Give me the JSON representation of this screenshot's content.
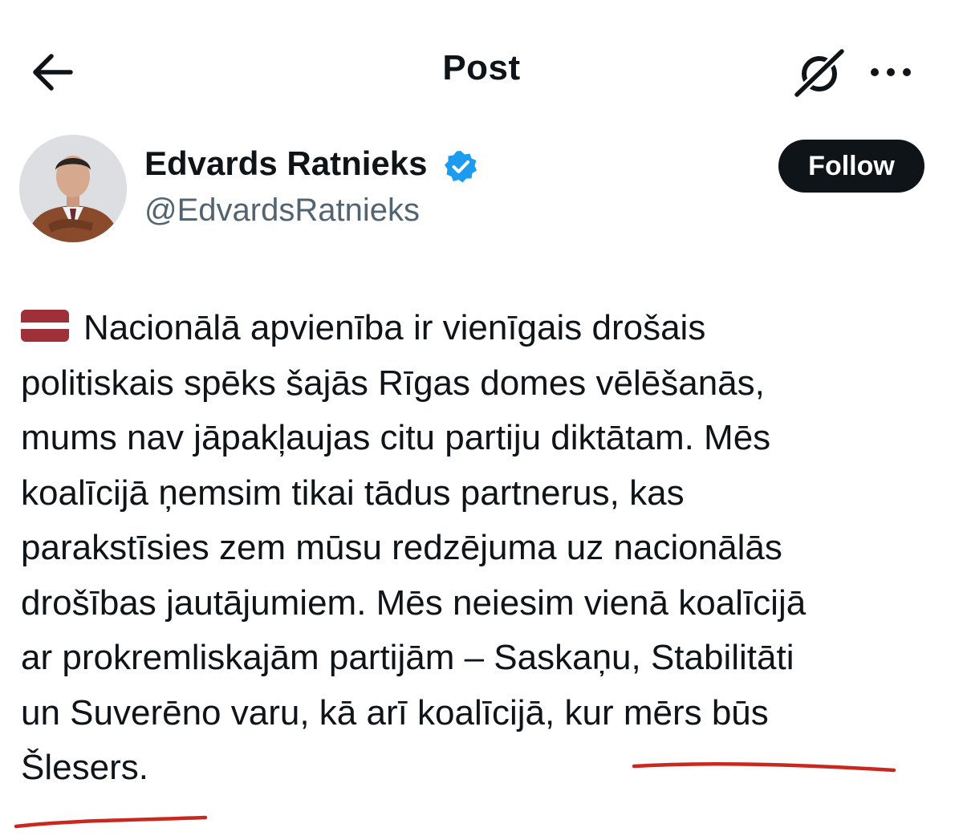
{
  "header": {
    "title": "Post",
    "back_icon": "arrow-left-icon",
    "grok_icon": "grok-icon",
    "more_icon": "more-horizontal-icon"
  },
  "author": {
    "display_name": "Edvards Ratnieks",
    "handle": "@EdvardsRatnieks",
    "verified": true,
    "verified_color": "#1d9bf0"
  },
  "follow_button": {
    "label": "Follow"
  },
  "post": {
    "flag_icon": "latvia-flag-icon",
    "lines": [
      "Nacionālā apvienība ir vienīgais drošais",
      "politiskais spēks šajās Rīgas domes vēlēšanās,",
      "mums nav jāpakļaujas citu partiju diktātam. Mēs",
      "koalīcijā ņemsim tikai tādus partnerus, kas",
      "parakstīsies zem mūsu redzējuma uz nacionālās",
      "drošības jautājumiem. Mēs neiesim vienā koalīcijā",
      "ar prokremliskajām partijām – Saskaņu, Stabilitāti",
      "un Suverēno varu, kā arī koalīcijā, kur mērs būs",
      "Šlesers."
    ]
  },
  "colors": {
    "text_primary": "#0f1419",
    "text_secondary": "#536471",
    "annotation_red": "#c8281e",
    "flag_carmine": "#9e3039"
  }
}
